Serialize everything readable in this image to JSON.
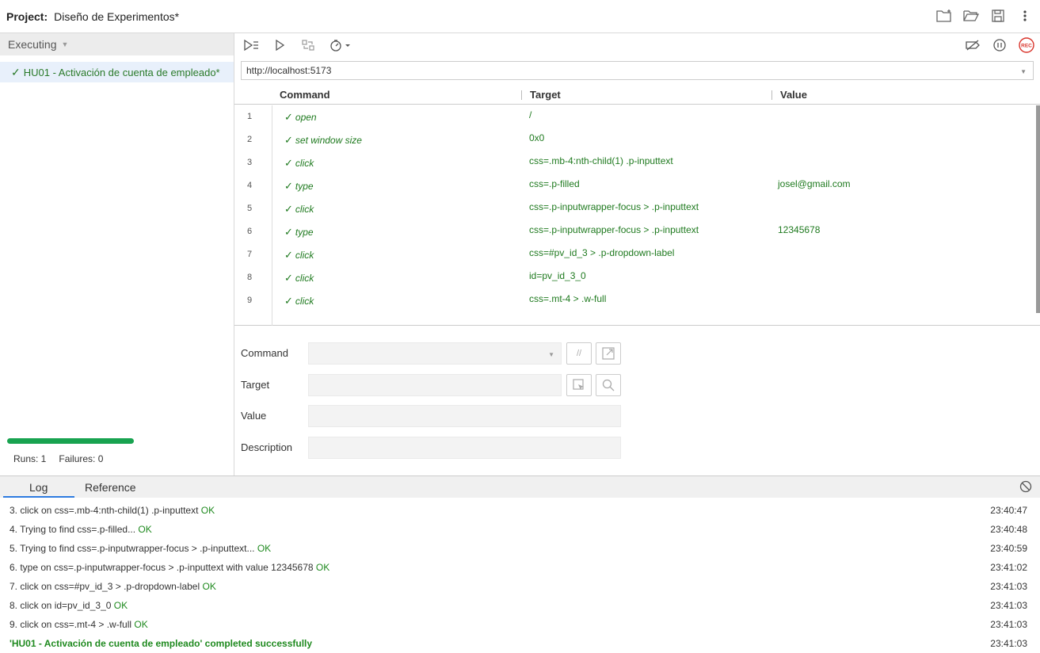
{
  "header": {
    "project_label": "Project:",
    "project_name": "Diseño de Experimentos*",
    "icons": [
      "new-folder-icon",
      "open-folder-icon",
      "save-icon",
      "more-vertical-icon"
    ]
  },
  "sidebar": {
    "executing_label": "Executing",
    "test_name": "HU01 - Activación de cuenta de empleado*",
    "progress_percent": 100,
    "runs_label": "Runs: 1",
    "failures_label": "Failures: 0"
  },
  "toolbar": {
    "left_icons": [
      "run-all-icon",
      "run-icon",
      "step-icon",
      "speed-icon"
    ],
    "right_icons": [
      "disable-breakpoints-icon",
      "pause-icon",
      "record-icon"
    ],
    "record_label": "REC"
  },
  "url": {
    "value": "http://localhost:5173"
  },
  "table": {
    "headers": {
      "command": "Command",
      "target": "Target",
      "value": "Value"
    },
    "rows": [
      {
        "num": "1",
        "command": "open",
        "target": "/",
        "value": ""
      },
      {
        "num": "2",
        "command": "set window size",
        "target": "0x0",
        "value": ""
      },
      {
        "num": "3",
        "command": "click",
        "target": "css=.mb-4:nth-child(1) .p-inputtext",
        "value": ""
      },
      {
        "num": "4",
        "command": "type",
        "target": "css=.p-filled",
        "value": "josel@gmail.com"
      },
      {
        "num": "5",
        "command": "click",
        "target": "css=.p-inputwrapper-focus > .p-inputtext",
        "value": ""
      },
      {
        "num": "6",
        "command": "type",
        "target": "css=.p-inputwrapper-focus > .p-inputtext",
        "value": "12345678"
      },
      {
        "num": "7",
        "command": "click",
        "target": "css=#pv_id_3 > .p-dropdown-label",
        "value": ""
      },
      {
        "num": "8",
        "command": "click",
        "target": "id=pv_id_3_0",
        "value": ""
      },
      {
        "num": "9",
        "command": "click",
        "target": "css=.mt-4 > .w-full",
        "value": ""
      }
    ]
  },
  "editor": {
    "command_label": "Command",
    "target_label": "Target",
    "value_label": "Value",
    "description_label": "Description",
    "comment_btn": "//"
  },
  "log": {
    "tabs": [
      "Log",
      "Reference"
    ],
    "entries": [
      {
        "text": "3.  click on css=.mb-4:nth-child(1) .p-inputtext ",
        "ok": "OK",
        "time": "23:40:47"
      },
      {
        "text": "4.  Trying to find css=.p-filled... ",
        "ok": "OK",
        "time": "23:40:48"
      },
      {
        "text": "5.  Trying to find css=.p-inputwrapper-focus > .p-inputtext... ",
        "ok": "OK",
        "time": "23:40:59"
      },
      {
        "text": "6.  type on css=.p-inputwrapper-focus > .p-inputtext with value 12345678 ",
        "ok": "OK",
        "time": "23:41:02"
      },
      {
        "text": "7.  click on css=#pv_id_3 > .p-dropdown-label ",
        "ok": "OK",
        "time": "23:41:03"
      },
      {
        "text": "8.  click on id=pv_id_3_0 ",
        "ok": "OK",
        "time": "23:41:03"
      },
      {
        "text": "9.  click on css=.mt-4 > .w-full ",
        "ok": "OK",
        "time": "23:41:03"
      }
    ],
    "final": {
      "text": "'HU01 - Activación de cuenta de empleado' completed successfully",
      "time": "23:41:03"
    }
  },
  "colors": {
    "success": "#1f7a1f",
    "progress": "#18a350",
    "record": "#d9342b",
    "tab_underline": "#2d7be0"
  }
}
